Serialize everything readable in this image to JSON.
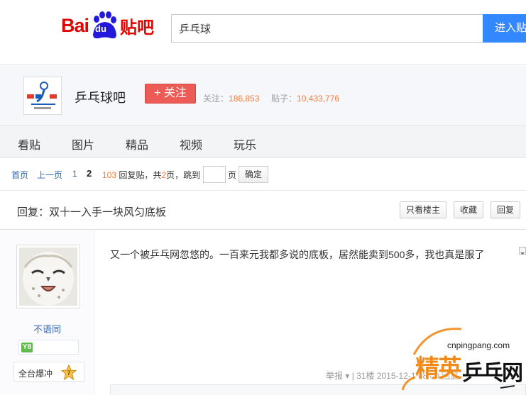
{
  "header": {
    "logo_bai": "Bai",
    "logo_du": "du",
    "logo_tieba": "贴吧",
    "search_value": "乒乓球",
    "enter_button": "进入贴"
  },
  "forum": {
    "name": "乒乓球吧",
    "follow_label": "+ 关注",
    "followers_label": "关注：",
    "followers": "186,853",
    "posts_label": "贴子：",
    "posts": "10,433,776"
  },
  "tabs": [
    "看贴",
    "图片",
    "精品",
    "视频",
    "玩乐"
  ],
  "pager": {
    "first": "首页",
    "prev": "上一页",
    "page1": "1",
    "page2": "2",
    "reply_count": "103",
    "reply_suffix": "回复贴，共",
    "total_pages": "2",
    "pages_suffix": "页，跳到",
    "page_unit": "页",
    "confirm": "确定"
  },
  "thread": {
    "title": "回复：双十一入手一块风匀底板",
    "only_author": "只看楼主",
    "favorite": "收藏",
    "reply": "回复"
  },
  "post": {
    "username": "不语同",
    "level_badge": "Y8",
    "honor_label": "全台爆冲",
    "honor_level": "7",
    "content": "又一个被乒乓网忽悠的。一百来元我都多说的底板，居然能卖到500多，我也真是服了",
    "meta": "举报 ▾ | 31楼   2015-12-1 08:00   回复"
  },
  "watermark": {
    "url": "cnpingpang.com",
    "brand": "精英",
    "site": "乒乓网"
  },
  "colors": {
    "brand_red": "#e10601",
    "brand_blue": "#2319dc",
    "search_button": "#3388ff",
    "follow_button": "#ec5b56",
    "stat_number": "#fa7b3c",
    "link": "#2d64b3"
  }
}
